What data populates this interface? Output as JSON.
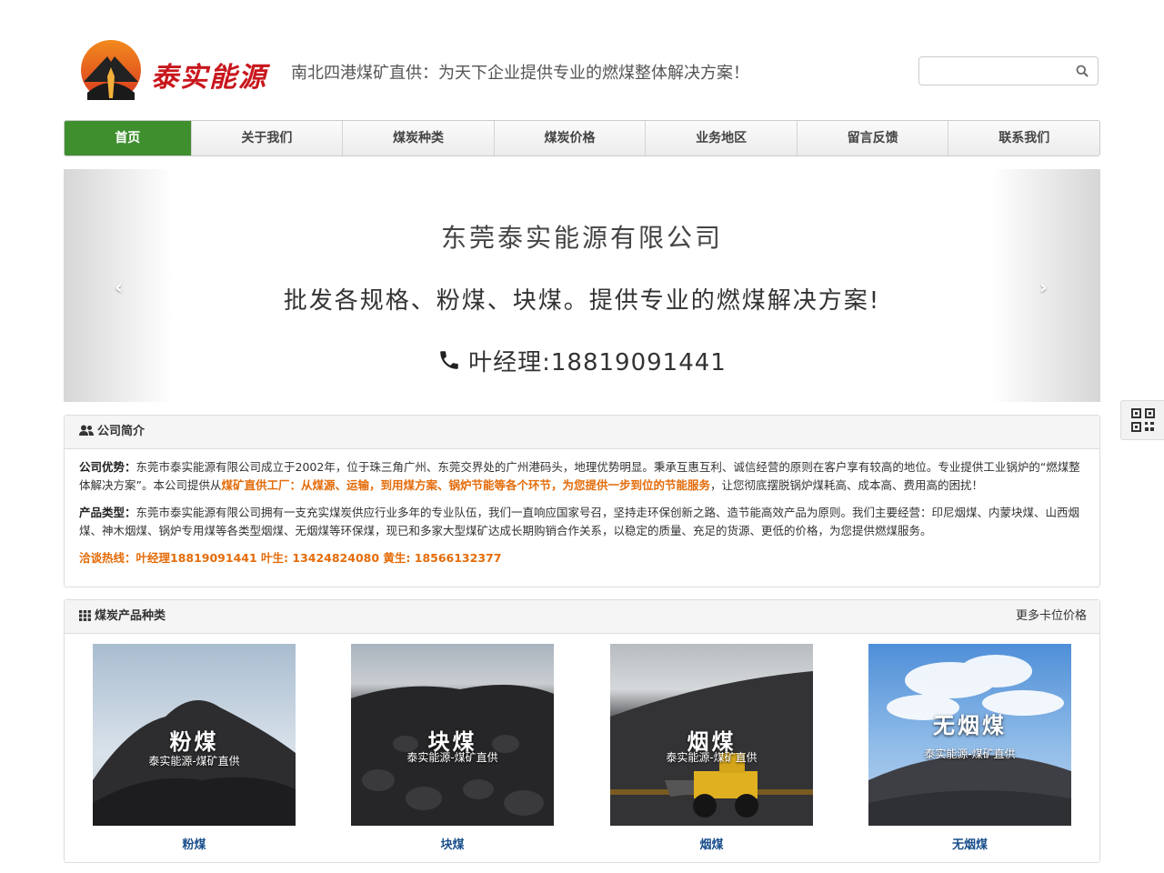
{
  "header": {
    "logo_text": "泰实能源",
    "slogan": "南北四港煤矿直供：为天下企业提供专业的燃煤整体解决方案！",
    "search_placeholder": ""
  },
  "nav": {
    "items": [
      {
        "label": "首页",
        "active": true
      },
      {
        "label": "关于我们",
        "active": false
      },
      {
        "label": "煤炭种类",
        "active": false
      },
      {
        "label": "煤炭价格",
        "active": false
      },
      {
        "label": "业务地区",
        "active": false
      },
      {
        "label": "留言反馈",
        "active": false
      },
      {
        "label": "联系我们",
        "active": false
      }
    ]
  },
  "banner": {
    "title": "东莞泰实能源有限公司",
    "subtitle": "批发各规格、粉煤、块煤。提供专业的燃煤解决方案!",
    "contact": "叶经理:18819091441",
    "prev": "‹",
    "next": "›"
  },
  "intro": {
    "heading": "公司简介",
    "advantage_label": "公司优势：",
    "advantage_text1": "东莞市泰实能源有限公司成立于2002年，位于珠三角广州、东莞交界处的广州港码头，地理优势明显。秉承互惠互利、诚信经营的原则在客户享有较高的地位。专业提供工业锅炉的“燃煤整体解决方案”。本公司提供从",
    "advantage_highlight": "煤矿直供工厂：从煤源、运输，到用煤方案、锅炉节能等各个环节，为您提供一步到位的节能服务",
    "advantage_text2": "，让您彻底摆脱锅炉煤耗高、成本高、费用高的困扰！",
    "products_label": "产品类型：",
    "products_text": "东莞市泰实能源有限公司拥有一支充实煤炭供应行业多年的专业队伍，我们一直响应国家号召，坚持走环保创新之路、造节能高效产品为原则。我们主要经营：印尼烟煤、内蒙块煤、山西烟煤、神木烟煤、锅炉专用煤等各类型烟煤、无烟煤等环保煤，现已和多家大型煤矿达成长期购销合作关系，以稳定的质量、充足的货源、更低的价格，为您提供燃煤服务。",
    "hotline": "洽谈热线：叶经理18819091441 叶生: 13424824080 黄生: 18566132377"
  },
  "products": {
    "heading": "煤炭产品种类",
    "more": "更多卡位价格",
    "items": [
      {
        "name": "粉煤",
        "caption": "粉煤",
        "sub": "泰实能源-煤矿直供"
      },
      {
        "name": "块煤",
        "caption": "块煤",
        "sub": "泰实能源-煤矿直供"
      },
      {
        "name": "烟煤",
        "caption": "烟煤",
        "sub": "泰实能源-煤矿直供"
      },
      {
        "name": "无烟煤",
        "caption": "无烟煤",
        "sub": "泰实能源-煤矿直供"
      }
    ]
  },
  "colors": {
    "accent_green": "#3f8f2f",
    "brand_red": "#c8171d",
    "highlight_orange": "#e46c0a",
    "link_blue": "#1a4f8c"
  }
}
